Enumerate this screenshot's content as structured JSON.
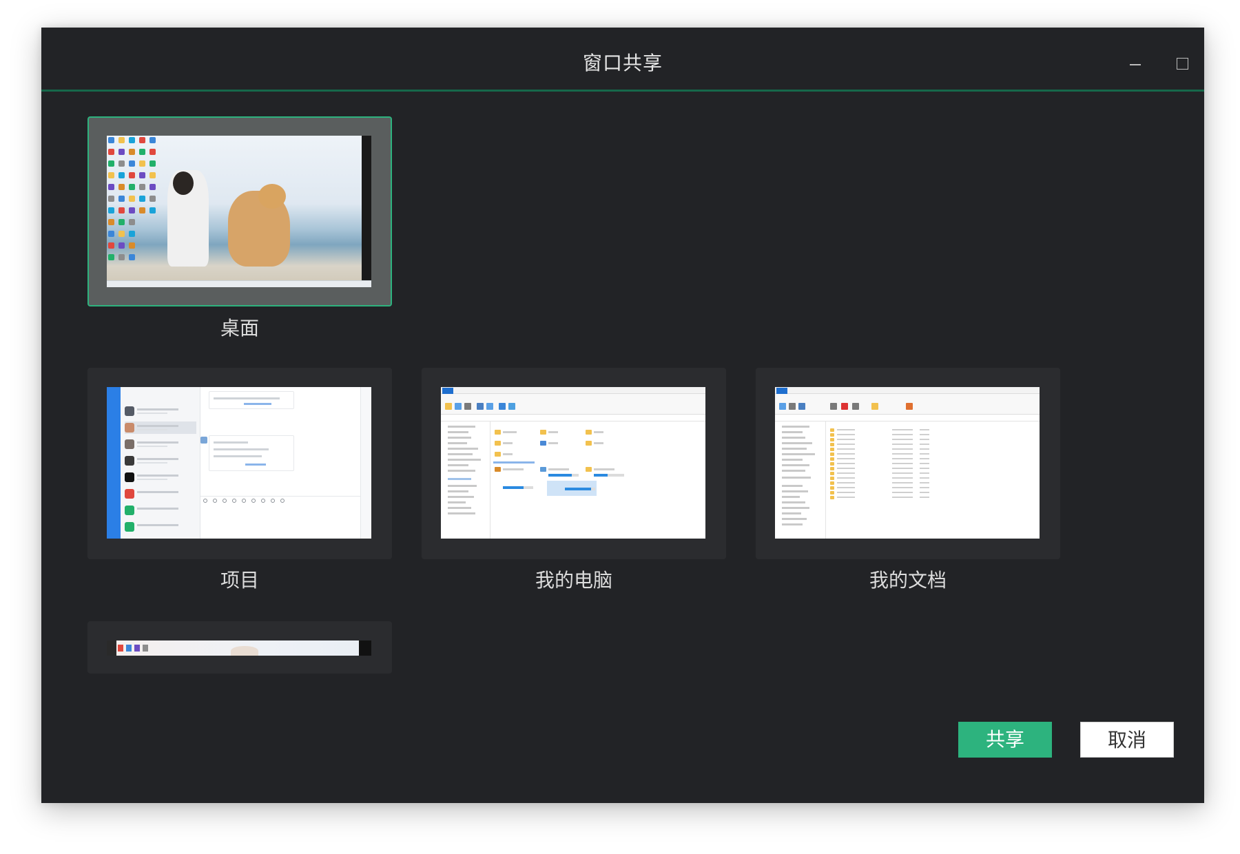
{
  "window": {
    "title": "窗口共享"
  },
  "sources": [
    {
      "label": "桌面",
      "selected": true
    },
    {
      "label": "项目",
      "selected": false
    },
    {
      "label": "我的电脑",
      "selected": false
    },
    {
      "label": "我的文档",
      "selected": false
    },
    {
      "label": "",
      "selected": false
    }
  ],
  "actions": {
    "share_label": "共享",
    "cancel_label": "取消"
  },
  "colors": {
    "accent": "#2db37e",
    "background": "#222326",
    "card": "#2b2c2f",
    "divider": "#16684a"
  },
  "icons": {
    "minimize": "minimize-icon",
    "maximize": "maximize-icon"
  }
}
